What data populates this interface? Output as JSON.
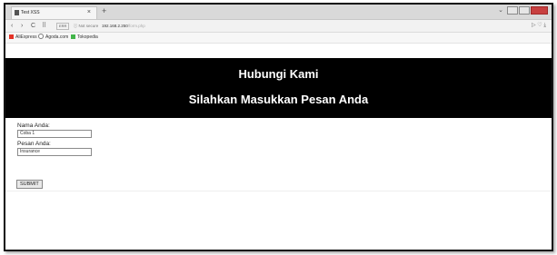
{
  "browser": {
    "tab_title": "Test XSS",
    "tab_close": "×",
    "new_tab": "+",
    "address": {
      "secure_label": "Not secure",
      "host": "192.168.2.250",
      "path": "/form.php",
      "badge": "ERR"
    },
    "nav": {
      "back": "‹",
      "forward": "›",
      "reload": "C",
      "apps": "⠿"
    },
    "toolbar_right": "▷ ♡ ⤓",
    "bookmarks": [
      {
        "label": "AliExpress",
        "icon_color": "#e43226"
      },
      {
        "label": "Agoda.com",
        "icon_color": "#7b7b7b"
      },
      {
        "label": "Tokopedia",
        "icon_color": "#42b549"
      }
    ]
  },
  "page": {
    "heading": "Hubungi Kami",
    "subheading": "Silahkan Masukkan Pesan Anda",
    "form": {
      "name_label": "Nama Anda:",
      "name_value": "Coba 1",
      "message_label": "Pesan Anda:",
      "message_value": "Insurance",
      "submit_label": "SUBMIT"
    }
  },
  "colors": {
    "hero_bg": "#000000",
    "hero_text": "#ffffff"
  }
}
